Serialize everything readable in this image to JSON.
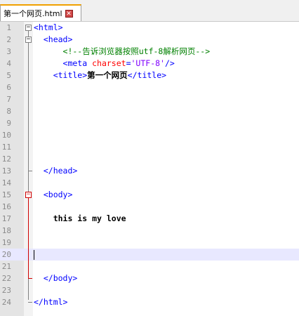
{
  "tab": {
    "title": "第一个网页.html",
    "close_glyph": "✕"
  },
  "lines": [
    {
      "n": "1",
      "segments": [
        {
          "t": "<html>",
          "c": "tag"
        }
      ]
    },
    {
      "n": "2",
      "segments": [
        {
          "t": "  <head>",
          "c": "tag"
        }
      ]
    },
    {
      "n": "3",
      "segments": [
        {
          "t": "      <!--告诉浏览器按照utf-8解析网页-->",
          "c": "comment"
        }
      ]
    },
    {
      "n": "4",
      "segments": [
        {
          "t": "      <meta ",
          "c": "tag"
        },
        {
          "t": "charset",
          "c": "attr"
        },
        {
          "t": "=",
          "c": "tag"
        },
        {
          "t": "'UTF-8'",
          "c": "val"
        },
        {
          "t": "/>",
          "c": "tag"
        }
      ]
    },
    {
      "n": "5",
      "segments": [
        {
          "t": "    <title>",
          "c": "tag"
        },
        {
          "t": "第一个网页",
          "c": "text"
        },
        {
          "t": "</title>",
          "c": "tag"
        }
      ]
    },
    {
      "n": "6",
      "segments": []
    },
    {
      "n": "7",
      "segments": []
    },
    {
      "n": "8",
      "segments": []
    },
    {
      "n": "9",
      "segments": []
    },
    {
      "n": "10",
      "segments": []
    },
    {
      "n": "11",
      "segments": []
    },
    {
      "n": "12",
      "segments": []
    },
    {
      "n": "13",
      "segments": [
        {
          "t": "  </head>",
          "c": "tag"
        }
      ]
    },
    {
      "n": "14",
      "segments": []
    },
    {
      "n": "15",
      "segments": [
        {
          "t": "  <body>",
          "c": "tag"
        }
      ]
    },
    {
      "n": "16",
      "segments": []
    },
    {
      "n": "17",
      "segments": [
        {
          "t": "    this is my love",
          "c": "text"
        }
      ]
    },
    {
      "n": "18",
      "segments": []
    },
    {
      "n": "19",
      "segments": []
    },
    {
      "n": "20",
      "segments": []
    },
    {
      "n": "21",
      "segments": []
    },
    {
      "n": "22",
      "segments": [
        {
          "t": "  </body>",
          "c": "tag"
        }
      ]
    },
    {
      "n": "23",
      "segments": []
    },
    {
      "n": "24",
      "segments": [
        {
          "t": "</html>",
          "c": "tag"
        }
      ]
    }
  ],
  "current_line": "20",
  "colors": {
    "tag": "#0000ff",
    "attribute": "#ff0000",
    "value": "#8000ff",
    "comment": "#008000",
    "current_line_bg": "#e8e8ff"
  }
}
